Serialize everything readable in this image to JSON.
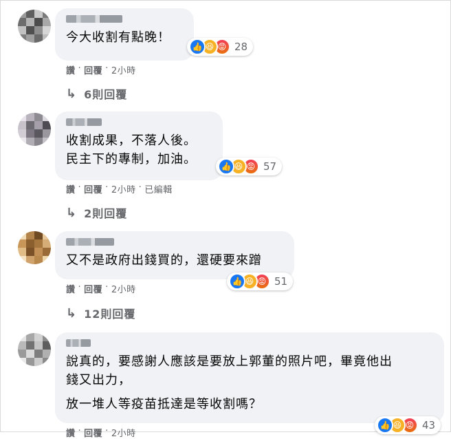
{
  "comments": [
    {
      "text_lines": [
        "今大收割有點晚！"
      ],
      "reaction_count": "28",
      "meta": {
        "like": "讚",
        "reply": "回覆",
        "time": "2小時",
        "edited": ""
      },
      "replies_label": "6則回覆"
    },
    {
      "text_lines": [
        "收割成果，不落人後。",
        "民主下的專制，加油。"
      ],
      "reaction_count": "57",
      "meta": {
        "like": "讚",
        "reply": "回覆",
        "time": "2小時",
        "edited": "已編輯"
      },
      "replies_label": "2則回覆"
    },
    {
      "text_lines": [
        "又不是政府出錢買的，還硬要來蹭"
      ],
      "reaction_count": "51",
      "meta": {
        "like": "讚",
        "reply": "回覆",
        "time": "2小時",
        "edited": ""
      },
      "replies_label": "12則回覆"
    },
    {
      "text_lines": [
        "說真的，要感謝人應該是要放上郭董的照片吧，畢竟他出",
        "錢又出力，",
        "放一堆人等疫苗抵達是等收割嗎？"
      ],
      "reaction_count": "43",
      "meta": {
        "like": "讚",
        "reply": "回覆",
        "time": "2小時",
        "edited": ""
      },
      "replies_label": ""
    }
  ],
  "icons": {
    "like": "thumbs-up-icon",
    "haha": "laughing-face-icon",
    "angry": "angry-face-icon",
    "reply_arrow": "reply-arrow-icon"
  },
  "colors": {
    "bubble": "#f0f2f5",
    "meta_text": "#65676b",
    "like_blue": "#1877f2"
  }
}
